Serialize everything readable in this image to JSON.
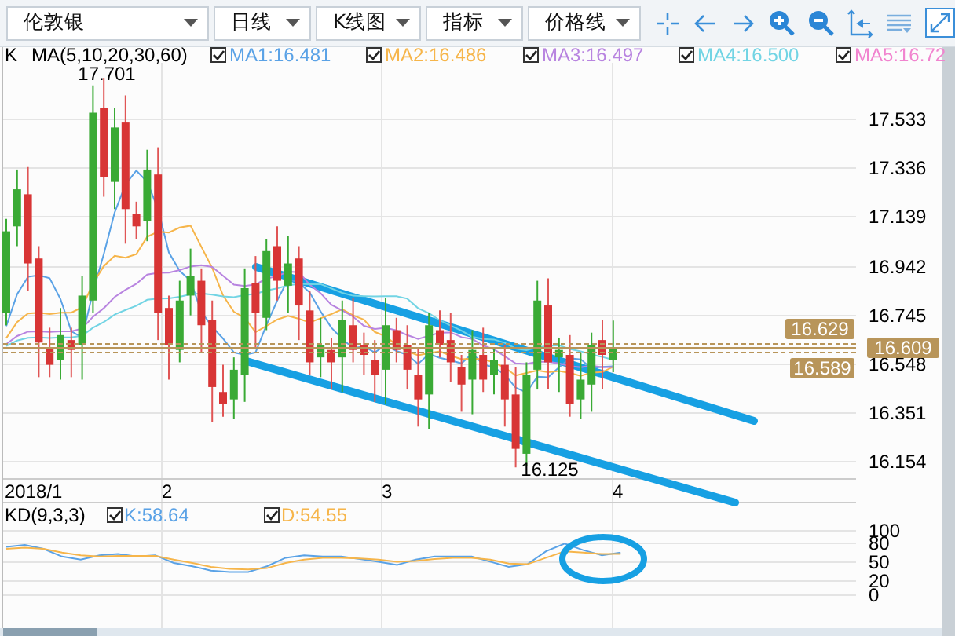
{
  "toolbar": {
    "dropdowns": [
      {
        "value": "伦敦银"
      },
      {
        "value": "日线"
      },
      {
        "value": "K线图"
      },
      {
        "value": "指标"
      },
      {
        "value": "价格线"
      }
    ]
  },
  "main_panel": {
    "label": "K",
    "indicator": "MA(5,10,20,30,60)",
    "legend": [
      {
        "text": "MA1:16.481",
        "checked": true,
        "color": "#5aa2e6"
      },
      {
        "text": "MA2:16.486",
        "checked": true,
        "color": "#f6b54a"
      },
      {
        "text": "MA3:16.497",
        "checked": true,
        "color": "#b884e0"
      },
      {
        "text": "MA4:16.500",
        "checked": true,
        "color": "#72d4e4"
      },
      {
        "text": "MA5:16.72",
        "checked": true,
        "color": "#f184cf"
      }
    ],
    "high_label": "17.701",
    "low_label": "16.125",
    "price_axis": [
      "17.533",
      "17.336",
      "17.139",
      "16.942",
      "16.745",
      "16.548",
      "16.351",
      "16.154"
    ],
    "price_tags": [
      {
        "text": "16.629"
      },
      {
        "text": "16.609"
      },
      {
        "text": "16.589"
      }
    ],
    "date_axis": [
      "2018/1",
      "2",
      "3",
      "4"
    ]
  },
  "kd_panel": {
    "indicator": "KD(9,3,3)",
    "legend": [
      {
        "text": "K:58.64",
        "checked": true,
        "color": "#5aa2e6"
      },
      {
        "text": "D:54.55",
        "checked": true,
        "color": "#f6b54a"
      }
    ],
    "axis": [
      "100",
      "80",
      "50",
      "20",
      "0"
    ]
  }
}
